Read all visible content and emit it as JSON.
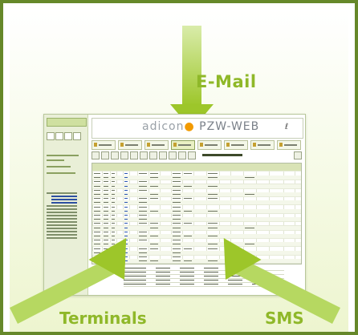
{
  "labels": {
    "email": "E-Mail",
    "terminals": "Terminals",
    "sms": "SMS"
  },
  "app": {
    "banner_brand_a": "adicon",
    "banner_brand_b": "PZW-WEB",
    "banner_icon": "ℓ"
  },
  "colors": {
    "frame": "#66882a",
    "arrow": "#9dc62a",
    "label": "#8fb829",
    "brand_orange": "#f29a00"
  }
}
